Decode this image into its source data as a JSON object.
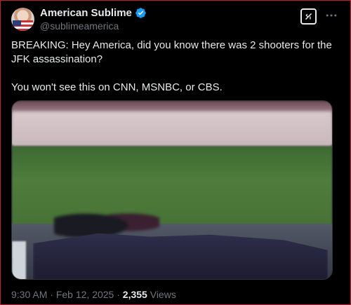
{
  "author": {
    "display_name": "American Sublime",
    "handle": "@sublimeamerica",
    "verified": true
  },
  "tweet": {
    "paragraphs": [
      "BREAKING: Hey America, did you know there was 2 shooters for the JFK assassination?",
      "You won't see this on CNN, MSNBC, or CBS."
    ]
  },
  "meta": {
    "time": "9:30 AM",
    "separator": "·",
    "date": "Feb 12, 2025",
    "views_count": "2,355",
    "views_label": "Views"
  },
  "icons": {
    "verified": "verified-badge-icon",
    "grok": "grok-icon",
    "more": "more-options-icon"
  },
  "colors": {
    "background": "#000000",
    "text_primary": "#e7e9ea",
    "text_secondary": "#71767b",
    "verified_blue": "#1d9bf0",
    "frame_border": "#c0202a"
  }
}
